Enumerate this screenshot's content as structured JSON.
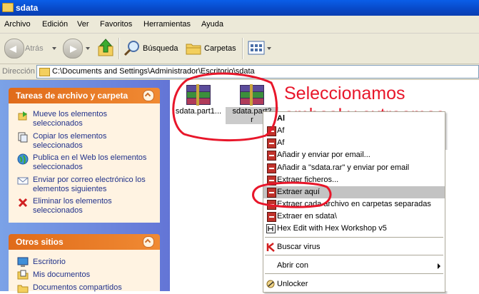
{
  "window": {
    "title": "sdata"
  },
  "menubar": {
    "items": [
      "Archivo",
      "Edición",
      "Ver",
      "Favoritos",
      "Herramientas",
      "Ayuda"
    ]
  },
  "toolbar": {
    "back": "Atrás",
    "search": "Búsqueda",
    "folders": "Carpetas"
  },
  "address": {
    "label": "Dirección",
    "path": "C:\\Documents and Settings\\Administrador\\Escritorio\\sdata"
  },
  "left_panel": {
    "tasks_title": "Tareas de archivo y carpeta",
    "tasks": [
      "Mueve los elementos seleccionados",
      "Copiar los elementos seleccionados",
      "Publica en el Web los elementos seleccionados",
      "Enviar por correo electrónico los elementos siguientes",
      "Eliminar los elementos seleccionados"
    ],
    "other_title": "Otros sitios",
    "other": [
      "Escritorio",
      "Mis documentos",
      "Documentos compartidos"
    ]
  },
  "files": [
    {
      "name": "sdata.part1..."
    },
    {
      "name": "sdata.part2",
      "name_line2": "r"
    }
  ],
  "annotation": {
    "line1": "Seleccionamos",
    "line2": "ambos! y extraemos",
    "color": "#e8162a"
  },
  "context_menu": {
    "partial_top": [
      "Al",
      "Af",
      "Af"
    ],
    "items": [
      "Añadir y enviar por email...",
      "Añadir a \"sdata.rar\" y enviar por email",
      "Extraer ficheros...",
      "Extraer aquí",
      "Extraer cada archivo en carpetas separadas",
      "Extraer en sdata\\",
      "Hex Edit with Hex Workshop v5",
      "Buscar virus",
      "Abrir con",
      "Unlocker"
    ],
    "highlighted": "Extraer aquí"
  }
}
